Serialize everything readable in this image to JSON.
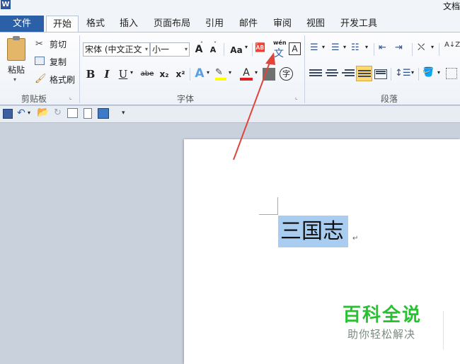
{
  "window": {
    "title": "文档"
  },
  "tabs": [
    {
      "label": "文件"
    },
    {
      "label": "开始"
    },
    {
      "label": "格式"
    },
    {
      "label": "插入"
    },
    {
      "label": "页面布局"
    },
    {
      "label": "引用"
    },
    {
      "label": "邮件"
    },
    {
      "label": "审阅"
    },
    {
      "label": "视图"
    },
    {
      "label": "开发工具"
    }
  ],
  "clipboard": {
    "paste_label": "粘贴",
    "cut_label": "剪切",
    "copy_label": "复制",
    "format_painter_label": "格式刷",
    "group_label": "剪贴板"
  },
  "font": {
    "font_name": "宋体 (中文正文",
    "font_size": "小一",
    "grow_label": "A",
    "shrink_label": "A",
    "case_label": "Aa",
    "phonetic_top": "wén",
    "phonetic_char": "文",
    "border_char": "A",
    "bold": "B",
    "italic": "I",
    "underline": "U",
    "strike": "abe",
    "subscript": "x₂",
    "superscript": "x²",
    "effects": "A",
    "font_color": "A",
    "enclose_char": "字",
    "group_label": "字体"
  },
  "paragraph": {
    "sort_label": "A↓Z",
    "group_label": "段落"
  },
  "document": {
    "selected_text": "三国志",
    "paragraph_mark": "↵"
  },
  "watermark": {
    "title": "百科全说",
    "subtitle": "助你轻松解决"
  },
  "colors": {
    "file_tab": "#2b5fa8",
    "selection": "#a8cdf0",
    "watermark_green": "#27c22f",
    "arrow": "#e0443a"
  }
}
